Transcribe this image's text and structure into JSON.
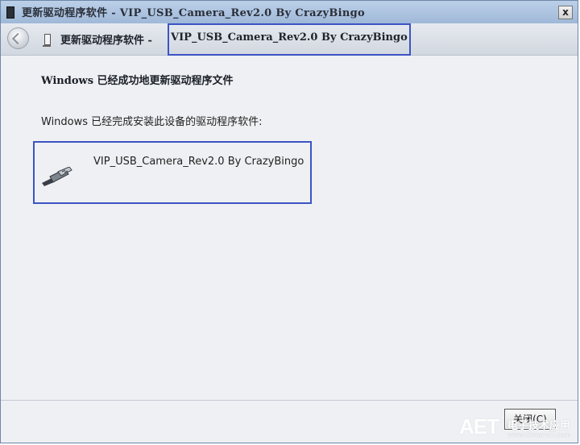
{
  "window": {
    "title": "更新驱动程序软件 - VIP_USB_Camera_Rev2.0 By CrazyBingo",
    "close_glyph": "x"
  },
  "nav": {
    "title_prefix": "更新驱动程序软件 -",
    "title_device": "VIP_USB_Camera_Rev2.0 By CrazyBingo"
  },
  "content": {
    "heading": "Windows 已经成功地更新驱动程序文件",
    "message": "Windows 已经完成安装此设备的驱动程序软件:",
    "device_name": "VIP_USB_Camera_Rev2.0 By CrazyBingo",
    "device_icon": "usb-connector-icon"
  },
  "footer": {
    "close_label": "关闭(C)"
  },
  "watermark": {
    "logo": "AET",
    "text": "电子技术应用",
    "url": "www.ChinaAET.com"
  },
  "colors": {
    "highlight_box": "#3c54c4",
    "titlebar": "#a8c0de"
  }
}
